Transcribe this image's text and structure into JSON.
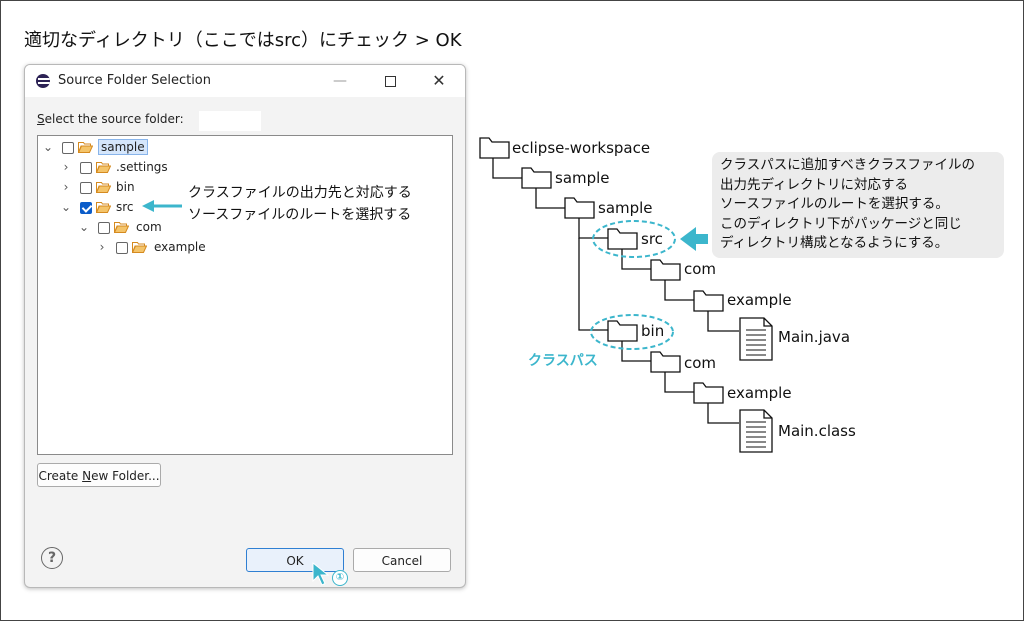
{
  "heading": "適切なディレクトリ（ここではsrc）にチェック > OK",
  "dialog": {
    "title": "Source Folder Selection",
    "window_buttons": {
      "minimize": "—",
      "close": "✕"
    },
    "select_label_prefix": "S",
    "select_label_rest": "elect the source folder:",
    "tree": [
      {
        "label": "sample",
        "expanded": true,
        "checked": false,
        "selected": true
      },
      {
        "label": ".settings",
        "expanded": false,
        "checked": false
      },
      {
        "label": "bin",
        "expanded": false,
        "checked": false
      },
      {
        "label": "src",
        "expanded": true,
        "checked": true
      },
      {
        "label": "com",
        "expanded": true,
        "checked": false
      },
      {
        "label": "example",
        "expanded": false,
        "checked": false
      }
    ],
    "annotation_line1": "クラスファイルの出力先と対応する",
    "annotation_line2": "ソースファイルのルートを選択する",
    "new_folder_prefix": "Create ",
    "new_folder_mnemonic": "N",
    "new_folder_rest": "ew Folder...",
    "help": "?",
    "ok_label": "OK",
    "cancel_label": "Cancel",
    "step_badge": "①"
  },
  "diagram": {
    "workspace": "eclipse-workspace",
    "project": "sample",
    "project_inner": "sample",
    "src": "src",
    "bin": "bin",
    "src_com": "com",
    "src_example": "example",
    "src_file": "Main.java",
    "bin_com": "com",
    "bin_example": "example",
    "bin_file": "Main.class",
    "classpath_label": "クラスパス",
    "callout": [
      "クラスパスに追加すべきクラスファイルの",
      "出力先ディレクトリに対応する",
      "ソースファイルのルートを選択する。",
      "このディレクトリ下がパッケージと同じ",
      "ディレクトリ構成となるようにする。"
    ]
  },
  "colors": {
    "accent": "#3cb6cc",
    "checkbox": "#0a5cc9",
    "folder": "#e8a33d"
  }
}
